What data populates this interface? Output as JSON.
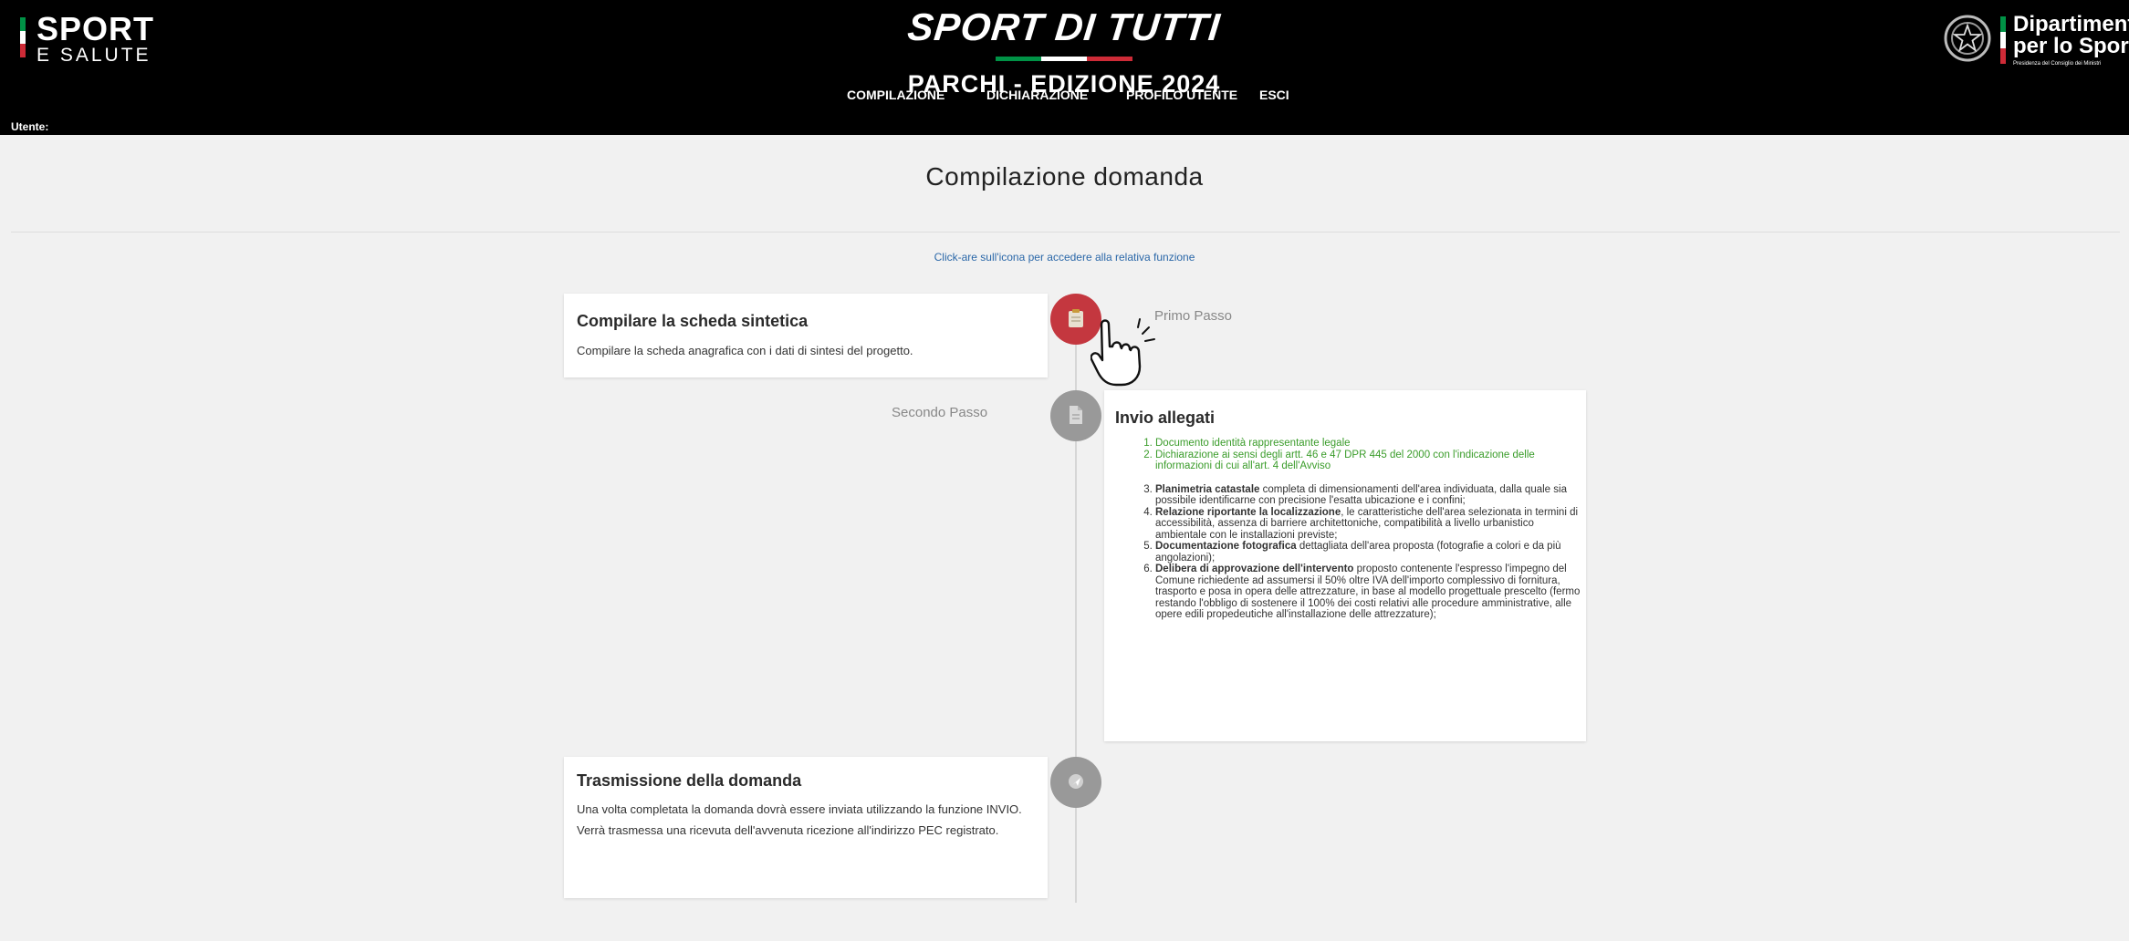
{
  "header": {
    "logo_left": {
      "line1": "SPORT",
      "line2": "E SALUTE"
    },
    "brand": {
      "title": "SPORT DI TUTTI",
      "subtitle": "PARCHI - EDIZIONE 2024"
    },
    "nav": [
      "COMPILAZIONE",
      "DICHIARAZIONE",
      "PROFILO UTENTE",
      "ESCI"
    ],
    "logo_right": {
      "line1": "Dipartimento",
      "line2": "per lo Sport",
      "line3": "Presidenza del Consiglio dei Ministri"
    },
    "user_label": "Utente:"
  },
  "main": {
    "title": "Compilazione domanda",
    "hint": "Click-are sull'icona per accedere alla relativa funzione",
    "steps": [
      {
        "label": "Primo Passo",
        "title": "Compilare la scheda sintetica",
        "description": "Compilare la scheda anagrafica con i dati di sintesi del progetto.",
        "icon": "clipboard-icon",
        "active": true
      },
      {
        "label": "Secondo Passo",
        "title": "Invio allegati",
        "icon": "document-icon",
        "items": [
          {
            "bold": "",
            "text": "Documento identità rappresentante legale"
          },
          {
            "bold": "",
            "text": "Dichiarazione ai sensi degli artt. 46 e 47 DPR 445 del 2000 con l'indicazione delle informazioni di cui all'art. 4 dell'Avviso"
          },
          {
            "bold": "Planimetria catastale",
            "text": " completa di dimensionamenti dell'area individuata, dalla quale sia possibile identificarne con precisione l'esatta ubicazione e i confini;"
          },
          {
            "bold": "Relazione riportante la localizzazione",
            "text": ", le caratteristiche dell'area selezionata in termini di accessibilità, assenza di barriere architettoniche, compatibilità a livello urbanistico ambientale con le installazioni previste;"
          },
          {
            "bold": "Documentazione fotografica",
            "text": " dettagliata dell'area proposta (fotografie a colori e da più angolazioni);"
          },
          {
            "bold": "Delibera di approvazione dell'intervento",
            "text": " proposto contenente l'espresso l'impegno del Comune richiedente ad assumersi il 50% oltre IVA dell'importo complessivo di fornitura, trasporto e posa in opera delle attrezzature, in base al modello progettuale prescelto (fermo restando l'obbligo di sostenere il 100% dei costi relativi alle procedure amministrative, alle opere edili propedeutiche all'installazione delle attrezzature);"
          }
        ]
      },
      {
        "label": "",
        "title": "Trasmissione della domanda",
        "icon": "send-icon",
        "lines": [
          "Una volta completata la domanda dovrà essere inviata utilizzando la funzione INVIO.",
          "Verrà trasmessa una ricevuta dell'avvenuta ricezione all'indirizzo PEC registrato."
        ]
      }
    ]
  },
  "colors": {
    "active": "#c4373f",
    "inactive": "#999999",
    "green": "#3a9c2a",
    "hint": "#2a67a8",
    "flag_green": "#009246",
    "flag_red": "#ce2b37"
  }
}
